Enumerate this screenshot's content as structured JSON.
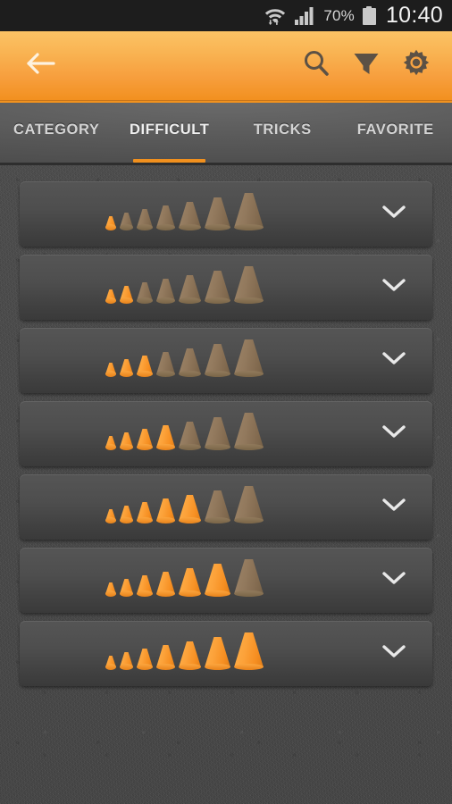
{
  "statusbar": {
    "wifi_icon": "wifi-icon",
    "signal_icon": "cellular-signal-icon",
    "battery_percent": "70%",
    "battery_icon": "battery-icon",
    "clock": "10:40"
  },
  "actionbar": {
    "back_icon": "back-arrow-icon",
    "search_icon": "search-icon",
    "filter_icon": "filter-icon",
    "settings_icon": "gear-icon",
    "background_color": "#f7a33f"
  },
  "tabs": [
    {
      "label": "CATEGORY",
      "active": false
    },
    {
      "label": "DIFFICULT",
      "active": true
    },
    {
      "label": "TRICKS",
      "active": false
    },
    {
      "label": "FAVORITE",
      "active": false
    }
  ],
  "tab_indicator_color": "#f1901e",
  "list": {
    "cone_total": 7,
    "expand_icon": "chevron-down-icon",
    "rows": [
      {
        "difficulty": 1
      },
      {
        "difficulty": 2
      },
      {
        "difficulty": 3
      },
      {
        "difficulty": 4
      },
      {
        "difficulty": 5
      },
      {
        "difficulty": 6
      },
      {
        "difficulty": 7
      }
    ]
  },
  "colors": {
    "cone_active": "#f89830",
    "cone_inactive": "#8a7258",
    "background": "#474747",
    "card": "#4b4b4b"
  }
}
